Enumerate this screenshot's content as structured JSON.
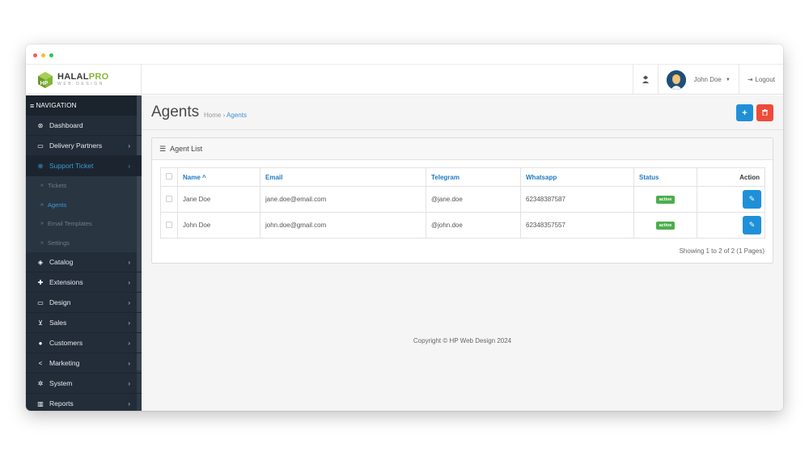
{
  "brand": {
    "name_part1": "HALAL",
    "name_part2": "PRO",
    "tagline": "WEB DESIGN"
  },
  "topbar": {
    "user_name": "John Doe",
    "logout_label": "Logout"
  },
  "sidebar": {
    "header": "NAVIGATION",
    "items": [
      {
        "label": "Dashboard",
        "icon": "dashboard-icon",
        "has_children": false
      },
      {
        "label": "Delivery Partners",
        "icon": "credit-card-icon",
        "has_children": true
      },
      {
        "label": "Support Ticket",
        "icon": "lifebuoy-icon",
        "has_children": true,
        "active": true
      },
      {
        "label": "Catalog",
        "icon": "tags-icon",
        "has_children": true
      },
      {
        "label": "Extensions",
        "icon": "puzzle-icon",
        "has_children": true
      },
      {
        "label": "Design",
        "icon": "monitor-icon",
        "has_children": true
      },
      {
        "label": "Sales",
        "icon": "cart-icon",
        "has_children": true
      },
      {
        "label": "Customers",
        "icon": "user-icon",
        "has_children": true
      },
      {
        "label": "Marketing",
        "icon": "share-icon",
        "has_children": true
      },
      {
        "label": "System",
        "icon": "gear-icon",
        "has_children": true
      },
      {
        "label": "Reports",
        "icon": "bar-chart-icon",
        "has_children": true
      }
    ],
    "sub_items": [
      {
        "label": "Tickets"
      },
      {
        "label": "Agents",
        "current": true
      },
      {
        "label": "Email Templates"
      },
      {
        "label": "Settings"
      }
    ]
  },
  "page": {
    "title": "Agents",
    "breadcrumb_home": "Home",
    "breadcrumb_sep": "›",
    "breadcrumb_current": "Agents"
  },
  "panel": {
    "title": "Agent List",
    "columns": {
      "name": "Name ^",
      "email": "Email",
      "telegram": "Telegram",
      "whatsapp": "Whatsapp",
      "status": "Status",
      "action": "Action"
    },
    "rows": [
      {
        "name": "Jane Doe",
        "email": "jane.doe@email.com",
        "telegram": "@jane.doe",
        "whatsapp": "62348387587",
        "status": "active"
      },
      {
        "name": "John Doe",
        "email": "john.doe@gmail.com",
        "telegram": "@john.doe",
        "whatsapp": "62348357557",
        "status": "active"
      }
    ],
    "pagination": "Showing 1 to 2 of 2 (1 Pages)"
  },
  "footer": {
    "copyright": "Copyright © HP Web Design 2024"
  },
  "colors": {
    "accent": "#1f90d8",
    "danger": "#ee4b3a",
    "success": "#4cae4c",
    "sidebar_bg": "#232d39",
    "brand_green": "#84b536"
  }
}
